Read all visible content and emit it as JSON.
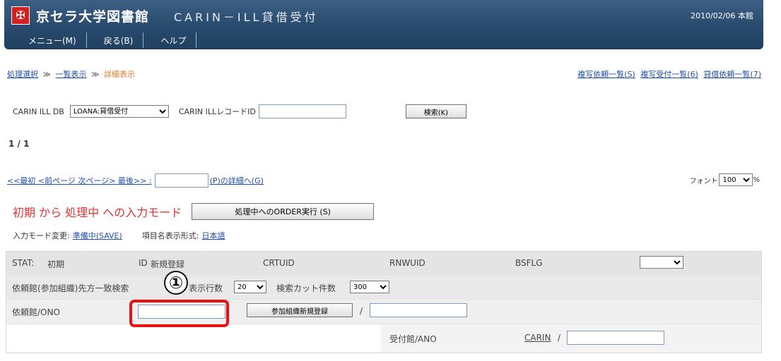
{
  "header": {
    "logo_glyph": "✠",
    "title": "京セラ大学図書館",
    "subtitle": "CARIN－ILL貸借受付",
    "date": "2010/02/06 本館",
    "menu": [
      {
        "label": "メニュー(M)"
      },
      {
        "label": "戻る(B)"
      },
      {
        "label": "ヘルプ"
      }
    ]
  },
  "breadcrumb": {
    "items": [
      "処理選択",
      "一覧表示",
      "詳細表示"
    ],
    "separator": "≫"
  },
  "top_links": [
    "複写依頼一覧(S)",
    "複写受付一覧(6)",
    "貸借依頼一覧(7)"
  ],
  "db_row": {
    "db_label": "CARIN ILL DB",
    "db_value": "LOANA:貸借受付",
    "record_label": "CARIN ILLレコードID",
    "record_value": "",
    "search_button": "検索(K)"
  },
  "page_count": "1 / 1",
  "nav": {
    "links": "<<最初 <前ページ 次ページ> 最後>> :",
    "page_input": "",
    "detail_link": "(P)の詳細へ(G)",
    "font_label": "フォント",
    "font_value": "100",
    "font_unit": "%"
  },
  "mode": {
    "title": "初期 から 処理中 への入力モード",
    "exec_button": "処理中へのORDER実行 (S)",
    "change_label": "入力モード変更:",
    "change_link": "準備中(SAVE)",
    "display_label": "項目名表示形式:",
    "display_link": "日本語"
  },
  "panel": {
    "stat_label": "STAT:",
    "stat_value": "初期",
    "id_label": "ID",
    "id_value": "新規登録",
    "crtuid": "CRTUID",
    "rnwuid": "RNWUID",
    "bsflg": "BSFLG",
    "bsflg_value": "",
    "search_label": "依頼館(参加組織)先方一致検索",
    "rows_label": "表示行数",
    "rows_value": "20",
    "cut_label": "検索カット件数",
    "cut_value": "300",
    "ono_label": "依頼館/ONO",
    "ono_value": "",
    "register_button": "参加組織新規登録",
    "slash": "/",
    "ono2_value": "",
    "ano_label": "受付館/ANO",
    "carin_link": "CARIN",
    "ano_value": ""
  },
  "annotation": {
    "marker": "①"
  },
  "colors": {
    "header": "#284a6d",
    "link": "#1f4fa8",
    "mode_title": "#e03434",
    "highlight": "#e81010",
    "breadcrumb_current": "#e07a2a"
  }
}
